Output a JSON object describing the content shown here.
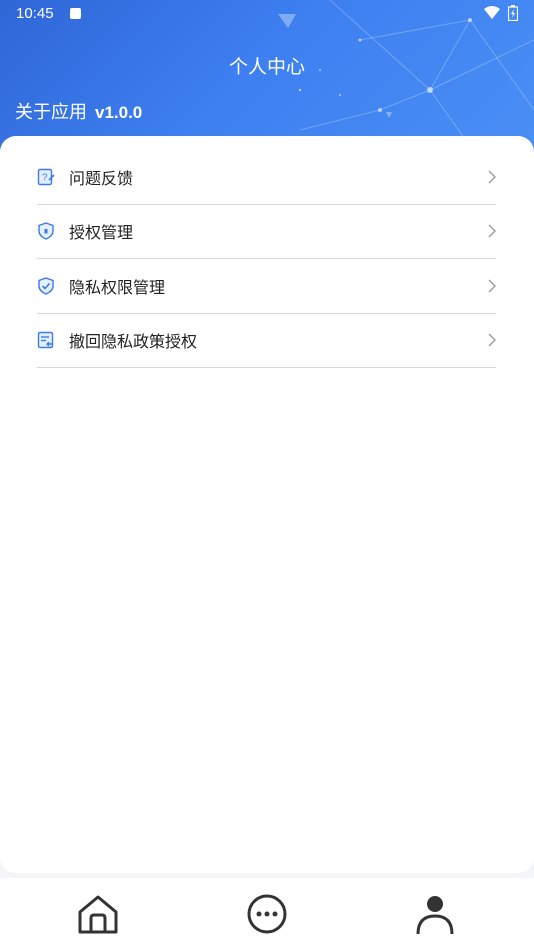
{
  "status_bar": {
    "time": "10:45"
  },
  "header": {
    "title": "个人中心",
    "about_label": "关于应用",
    "version": "v1.0.0"
  },
  "menu": {
    "items": [
      {
        "label": "问题反馈",
        "icon": "feedback-icon"
      },
      {
        "label": "授权管理",
        "icon": "shield-lock-icon"
      },
      {
        "label": "隐私权限管理",
        "icon": "shield-check-icon"
      },
      {
        "label": "撤回隐私政策授权",
        "icon": "revoke-document-icon"
      }
    ]
  },
  "tabbar": {
    "tabs": [
      {
        "icon": "home-icon"
      },
      {
        "icon": "chat-icon"
      },
      {
        "icon": "user-icon",
        "active": true
      }
    ]
  },
  "colors": {
    "header_blue": "#3d7ff0",
    "icon_blue": "#3a7be6",
    "text": "#222222",
    "divider": "#d8d8d8"
  }
}
